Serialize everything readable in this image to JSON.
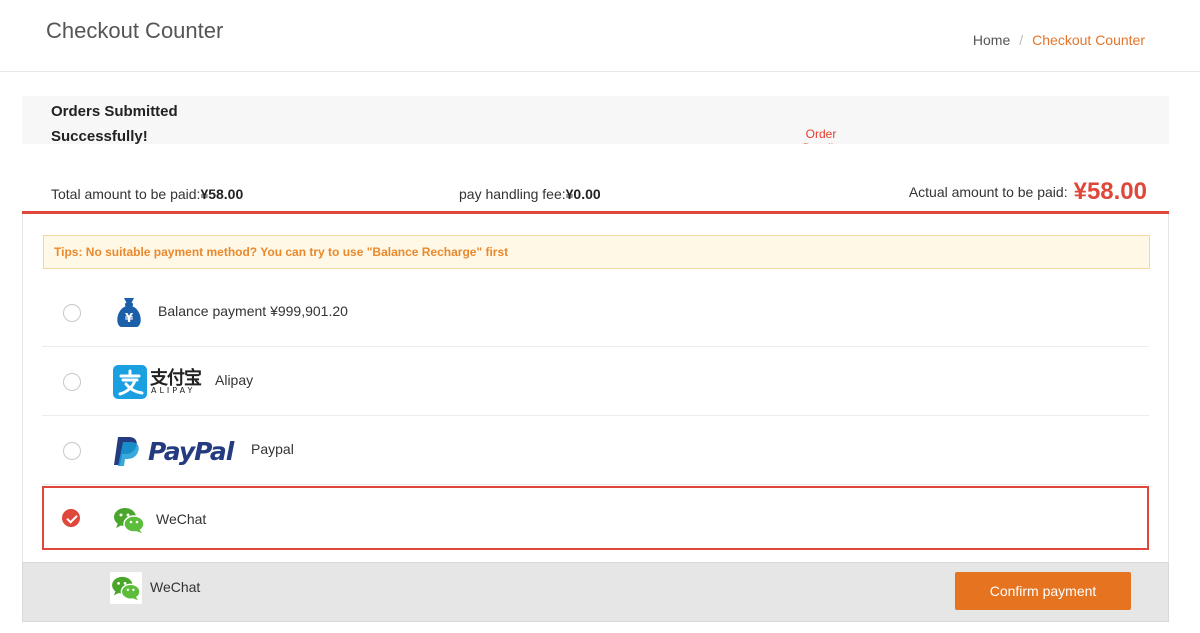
{
  "header": {
    "title": "Checkout Counter",
    "breadcrumb": {
      "home": "Home",
      "separator": "/",
      "current": "Checkout Counter"
    }
  },
  "success": {
    "message": "Orders Submitted Successfully!",
    "order_details_link": "Order Details"
  },
  "totals": {
    "total_label": "Total amount to be paid:",
    "total_value": "¥58.00",
    "fee_label": "pay handling fee:",
    "fee_value": "¥0.00",
    "actual_label": "Actual amount to be paid:",
    "actual_value": "¥58.00"
  },
  "tips": "Tips: No suitable payment method? You can try to use \"Balance Recharge\" first",
  "methods": [
    {
      "id": "balance",
      "icon": "money-bag-icon",
      "label": "Balance payment  ¥999,901.20",
      "selected": false
    },
    {
      "id": "alipay",
      "icon": "alipay-logo",
      "logo_text": "支付宝",
      "logo_sub": "ALIPAY",
      "label": "Alipay",
      "selected": false
    },
    {
      "id": "paypal",
      "icon": "paypal-logo",
      "logo_text": "PayPal",
      "label": "Paypal",
      "selected": false
    },
    {
      "id": "wechat",
      "icon": "wechat-icon",
      "label": "WeChat",
      "selected": true
    }
  ],
  "confirm_bar": {
    "selected_label": "WeChat",
    "button": "Confirm payment"
  },
  "colors": {
    "accent": "#e0473b",
    "button": "#e5731f",
    "breadcrumb_current": "#e5742b",
    "tips_text": "#e8892d",
    "wechat": "#49a62b",
    "alipay": "#1a9fe0",
    "paypal_dark": "#253b80",
    "paypal_light": "#179bd7"
  }
}
